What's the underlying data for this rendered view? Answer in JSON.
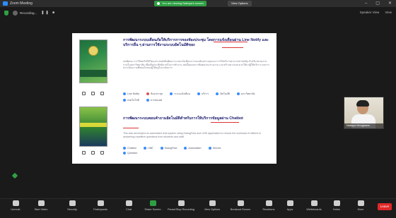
{
  "window": {
    "title": "Zoom Meeting",
    "share_banner": "You are viewing Nattaya's screen",
    "view_options": "View Options"
  },
  "meeting": {
    "recording_label": "Recording...",
    "right_items": [
      "Speaker View",
      "View"
    ]
  },
  "document": {
    "section1": {
      "title": "การพัฒนาระบบเตือนภัยให้บริการการจองห้องประชุม โดยการแจ้งเตือนผ่าน Line Notify และบริการอื่น ๆ ผ่านการใช้งานระบบอัตโนมัติของ",
      "body": "บทคัดย่อ การวิจัยครั้งนี้มีวัตถุประสงค์เพื่อพัฒนาระบบแจ้งเตือนการจองห้องประชุมและการให้บริการผ่าน Line Notify สำหรับหน่วยงานภายในมหาวิทยาลัย เพื่อเพิ่มประสิทธิภาพในการทำงาน ลดขั้นตอนการติดต่อประสานงาน และสร้างความสะดวกให้แก่ผู้ใช้บริการ ผลการประเมินความพึงพอใจของผู้ใช้อยู่ในระดับมาก",
      "tags": [
        "Line Notify",
        "ห้องประชุม",
        "ระบบแจ้งเตือน",
        "บริการ",
        "อัตโนมัติ",
        "มหาวิทยาลัย",
        "เทคโนโลยี",
        "สารสนเทศ"
      ]
    },
    "section2": {
      "title": "การพัฒนาระบบตอบคำถามอัตโนมัติสำหรับการให้บริการข้อมูลผ่าน Chatbot",
      "body": "This was developed an automated chat system using DialogFlow and LINE application to reduce the workload of officers in answering repetitive questions from students and staff.",
      "tags": [
        "Chatbot",
        "LINE",
        "DialogFlow",
        "Automation",
        "Service",
        "Question"
      ]
    }
  },
  "participant": {
    "name": "Nattaya Wongkaew"
  },
  "toolbar": {
    "items": [
      "Unmute",
      "Start Video",
      "Security",
      "Participants",
      "Chat",
      "Share Screen",
      "Pause/Stop Recording",
      "View Options",
      "Breakout Rooms",
      "Reactions",
      "Apps",
      "Whiteboards",
      "Notes",
      "More"
    ],
    "end_label": "Leave"
  },
  "colors": {
    "share_green": "#2ea043",
    "end_red": "#e02828",
    "heading_blue": "#1a1a6e",
    "annotation_red": "#dd3333"
  }
}
